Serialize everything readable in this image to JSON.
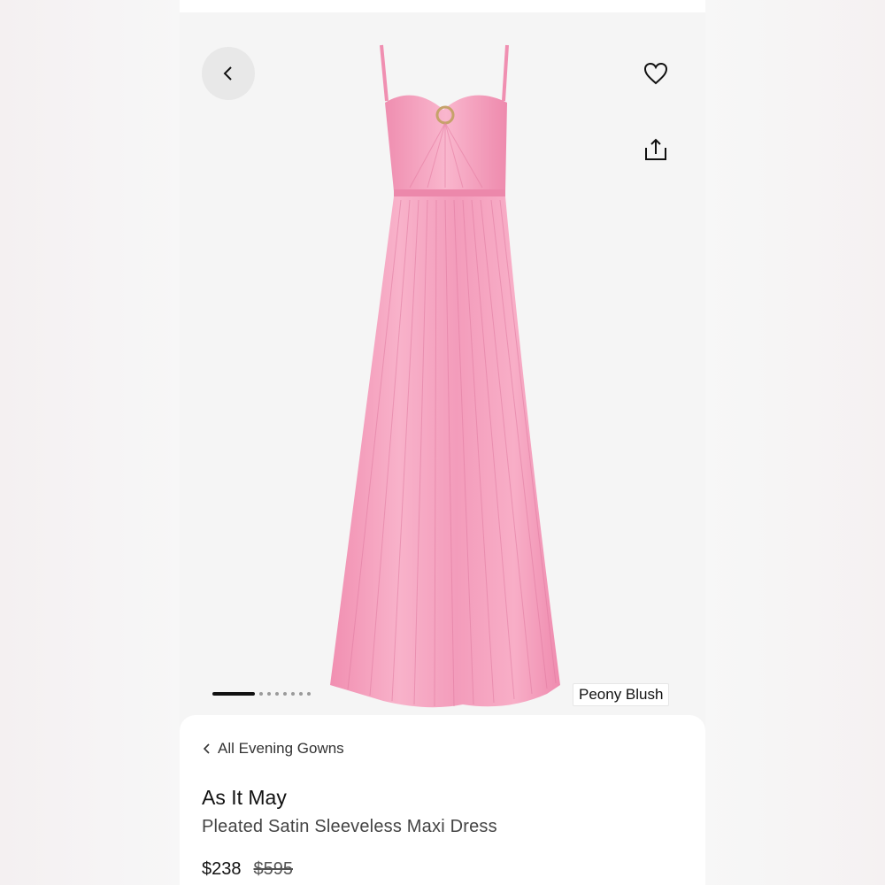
{
  "header": {
    "back_icon": "chevron-left-icon",
    "favorite_icon": "heart-icon",
    "share_icon": "share-icon"
  },
  "gallery": {
    "pages_total": 8,
    "current_page": 1,
    "color_label": "Peony Blush"
  },
  "product": {
    "breadcrumb": "All Evening Gowns",
    "brand": "As It May",
    "name": "Pleated Satin Sleeveless Maxi Dress",
    "price": "$238",
    "original_price": "$595"
  },
  "colors": {
    "dress": "#f4a3c0",
    "accent": "#111111"
  }
}
